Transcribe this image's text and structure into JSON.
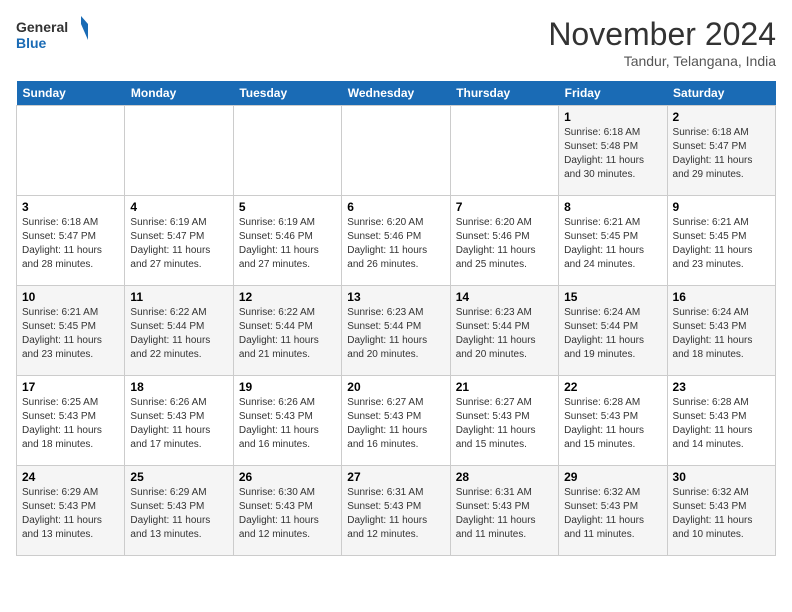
{
  "logo": {
    "line1": "General",
    "line2": "Blue"
  },
  "title": "November 2024",
  "subtitle": "Tandur, Telangana, India",
  "weekdays": [
    "Sunday",
    "Monday",
    "Tuesday",
    "Wednesday",
    "Thursday",
    "Friday",
    "Saturday"
  ],
  "weeks": [
    [
      {
        "day": "",
        "info": ""
      },
      {
        "day": "",
        "info": ""
      },
      {
        "day": "",
        "info": ""
      },
      {
        "day": "",
        "info": ""
      },
      {
        "day": "",
        "info": ""
      },
      {
        "day": "1",
        "info": "Sunrise: 6:18 AM\nSunset: 5:48 PM\nDaylight: 11 hours and 30 minutes."
      },
      {
        "day": "2",
        "info": "Sunrise: 6:18 AM\nSunset: 5:47 PM\nDaylight: 11 hours and 29 minutes."
      }
    ],
    [
      {
        "day": "3",
        "info": "Sunrise: 6:18 AM\nSunset: 5:47 PM\nDaylight: 11 hours and 28 minutes."
      },
      {
        "day": "4",
        "info": "Sunrise: 6:19 AM\nSunset: 5:47 PM\nDaylight: 11 hours and 27 minutes."
      },
      {
        "day": "5",
        "info": "Sunrise: 6:19 AM\nSunset: 5:46 PM\nDaylight: 11 hours and 27 minutes."
      },
      {
        "day": "6",
        "info": "Sunrise: 6:20 AM\nSunset: 5:46 PM\nDaylight: 11 hours and 26 minutes."
      },
      {
        "day": "7",
        "info": "Sunrise: 6:20 AM\nSunset: 5:46 PM\nDaylight: 11 hours and 25 minutes."
      },
      {
        "day": "8",
        "info": "Sunrise: 6:21 AM\nSunset: 5:45 PM\nDaylight: 11 hours and 24 minutes."
      },
      {
        "day": "9",
        "info": "Sunrise: 6:21 AM\nSunset: 5:45 PM\nDaylight: 11 hours and 23 minutes."
      }
    ],
    [
      {
        "day": "10",
        "info": "Sunrise: 6:21 AM\nSunset: 5:45 PM\nDaylight: 11 hours and 23 minutes."
      },
      {
        "day": "11",
        "info": "Sunrise: 6:22 AM\nSunset: 5:44 PM\nDaylight: 11 hours and 22 minutes."
      },
      {
        "day": "12",
        "info": "Sunrise: 6:22 AM\nSunset: 5:44 PM\nDaylight: 11 hours and 21 minutes."
      },
      {
        "day": "13",
        "info": "Sunrise: 6:23 AM\nSunset: 5:44 PM\nDaylight: 11 hours and 20 minutes."
      },
      {
        "day": "14",
        "info": "Sunrise: 6:23 AM\nSunset: 5:44 PM\nDaylight: 11 hours and 20 minutes."
      },
      {
        "day": "15",
        "info": "Sunrise: 6:24 AM\nSunset: 5:44 PM\nDaylight: 11 hours and 19 minutes."
      },
      {
        "day": "16",
        "info": "Sunrise: 6:24 AM\nSunset: 5:43 PM\nDaylight: 11 hours and 18 minutes."
      }
    ],
    [
      {
        "day": "17",
        "info": "Sunrise: 6:25 AM\nSunset: 5:43 PM\nDaylight: 11 hours and 18 minutes."
      },
      {
        "day": "18",
        "info": "Sunrise: 6:26 AM\nSunset: 5:43 PM\nDaylight: 11 hours and 17 minutes."
      },
      {
        "day": "19",
        "info": "Sunrise: 6:26 AM\nSunset: 5:43 PM\nDaylight: 11 hours and 16 minutes."
      },
      {
        "day": "20",
        "info": "Sunrise: 6:27 AM\nSunset: 5:43 PM\nDaylight: 11 hours and 16 minutes."
      },
      {
        "day": "21",
        "info": "Sunrise: 6:27 AM\nSunset: 5:43 PM\nDaylight: 11 hours and 15 minutes."
      },
      {
        "day": "22",
        "info": "Sunrise: 6:28 AM\nSunset: 5:43 PM\nDaylight: 11 hours and 15 minutes."
      },
      {
        "day": "23",
        "info": "Sunrise: 6:28 AM\nSunset: 5:43 PM\nDaylight: 11 hours and 14 minutes."
      }
    ],
    [
      {
        "day": "24",
        "info": "Sunrise: 6:29 AM\nSunset: 5:43 PM\nDaylight: 11 hours and 13 minutes."
      },
      {
        "day": "25",
        "info": "Sunrise: 6:29 AM\nSunset: 5:43 PM\nDaylight: 11 hours and 13 minutes."
      },
      {
        "day": "26",
        "info": "Sunrise: 6:30 AM\nSunset: 5:43 PM\nDaylight: 11 hours and 12 minutes."
      },
      {
        "day": "27",
        "info": "Sunrise: 6:31 AM\nSunset: 5:43 PM\nDaylight: 11 hours and 12 minutes."
      },
      {
        "day": "28",
        "info": "Sunrise: 6:31 AM\nSunset: 5:43 PM\nDaylight: 11 hours and 11 minutes."
      },
      {
        "day": "29",
        "info": "Sunrise: 6:32 AM\nSunset: 5:43 PM\nDaylight: 11 hours and 11 minutes."
      },
      {
        "day": "30",
        "info": "Sunrise: 6:32 AM\nSunset: 5:43 PM\nDaylight: 11 hours and 10 minutes."
      }
    ]
  ]
}
